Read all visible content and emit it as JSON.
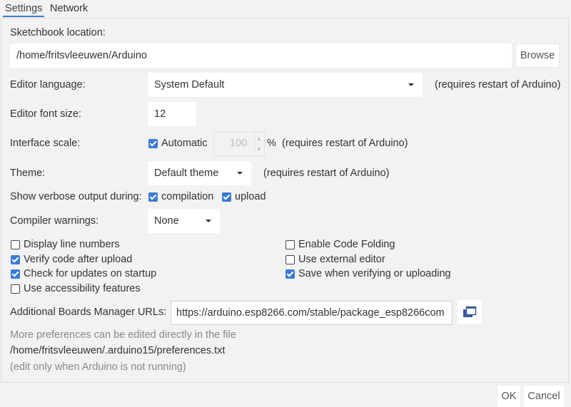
{
  "tabs": [
    {
      "label": "Settings",
      "active": true
    },
    {
      "label": "Network",
      "active": false
    }
  ],
  "sketchbook": {
    "label": "Sketchbook location:",
    "value": "/home/fritsvleeuwen/Arduino",
    "browse": "Browse"
  },
  "language": {
    "label": "Editor language:",
    "value": "System Default",
    "note": "(requires restart of Arduino)"
  },
  "font_size": {
    "label": "Editor font size:",
    "value": "12"
  },
  "scale": {
    "label": "Interface scale:",
    "automatic_label": "Automatic",
    "automatic_checked": true,
    "value": "100",
    "unit": "%",
    "note": "(requires restart of Arduino)"
  },
  "theme": {
    "label": "Theme:",
    "value": "Default theme",
    "note": "(requires restart of Arduino)"
  },
  "verbose": {
    "label": "Show verbose output during:",
    "compilation": "compilation",
    "compilation_checked": true,
    "upload": "upload",
    "upload_checked": true
  },
  "warnings": {
    "label": "Compiler warnings:",
    "value": "None"
  },
  "options": [
    {
      "label": "Display line numbers",
      "checked": false
    },
    {
      "label": "Verify code after upload",
      "checked": true
    },
    {
      "label": "Check for updates on startup",
      "checked": true
    },
    {
      "label": "Use accessibility features",
      "checked": false
    },
    {
      "label": "Enable Code Folding",
      "checked": false
    },
    {
      "label": "Use external editor",
      "checked": false
    },
    {
      "label": "Save when verifying or uploading",
      "checked": true
    }
  ],
  "boards": {
    "label": "Additional Boards Manager URLs:",
    "value": "https://arduino.esp8266.com/stable/package_esp8266com",
    "icon": "window-list-icon"
  },
  "info": {
    "line1": "More preferences can be edited directly in the file",
    "line2": "/home/fritsvleeuwen/.arduino15/preferences.txt",
    "line3": "(edit only when Arduino is not running)"
  },
  "footer": {
    "ok": "OK",
    "cancel": "Cancel"
  },
  "colors": {
    "accent": "#3a7bd5",
    "background": "#f2f2f2"
  }
}
